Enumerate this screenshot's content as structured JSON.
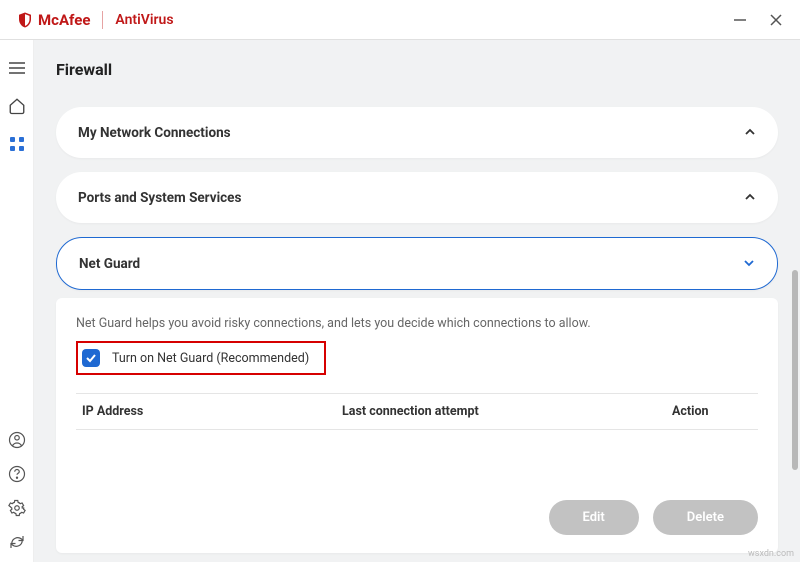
{
  "brand": {
    "name": "McAfee",
    "product": "AntiVirus"
  },
  "page": {
    "title": "Firewall"
  },
  "accordions": {
    "network": {
      "label": "My Network Connections"
    },
    "ports": {
      "label": "Ports and System Services"
    },
    "netguard": {
      "label": "Net Guard"
    }
  },
  "netguard": {
    "description": "Net Guard helps you avoid risky connections, and lets you decide which connections to allow.",
    "checkbox_label": "Turn on Net Guard (Recommended)",
    "checked": true,
    "columns": {
      "ip": "IP Address",
      "last": "Last connection attempt",
      "action": "Action"
    },
    "buttons": {
      "edit": "Edit",
      "delete": "Delete"
    }
  },
  "watermark": "wsxdn.com"
}
